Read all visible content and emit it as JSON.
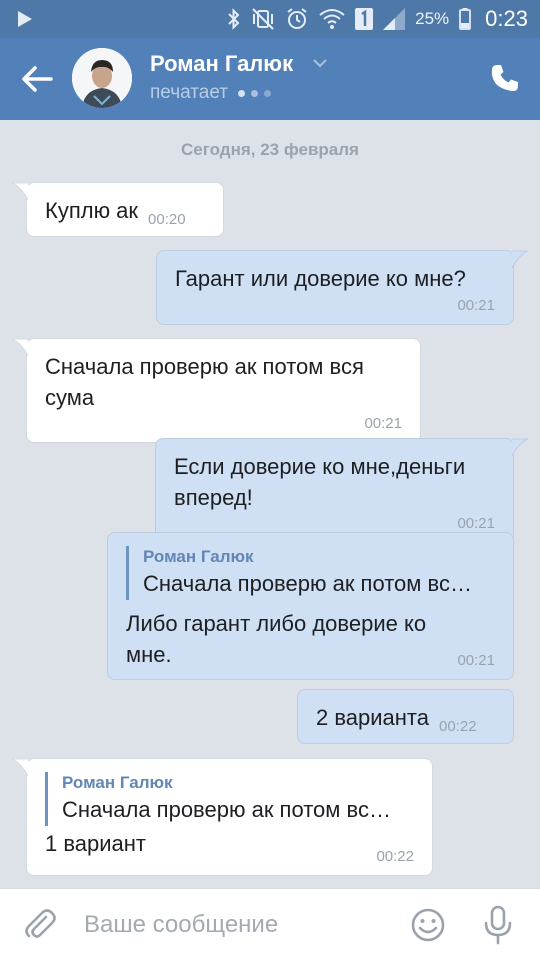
{
  "status_bar": {
    "battery_percent": "25%",
    "time": "0:23",
    "icons": [
      "play-icon",
      "bluetooth-icon",
      "vibrate-mute-icon",
      "alarm-icon",
      "wifi-icon",
      "sim-1-icon",
      "signal-icon",
      "battery-icon"
    ]
  },
  "header": {
    "contact_name": "Роман Галюк",
    "status": "печатает",
    "icons": [
      "back-arrow-icon",
      "avatar",
      "chevron-down-icon",
      "phone-icon"
    ],
    "background": "#5181b8"
  },
  "chat": {
    "date_separator": "Сегодня, 23 февраля",
    "messages": [
      {
        "direction": "in",
        "text": "Куплю ак",
        "time": "00:20"
      },
      {
        "direction": "out",
        "text": "Гарант или доверие ко мне?",
        "time": "00:21"
      },
      {
        "direction": "in",
        "text": "Сначала проверю ак потом вся сума",
        "time": "00:21"
      },
      {
        "direction": "out",
        "text": "Если доверие ко мне,деньги вперед!",
        "time": "00:21"
      },
      {
        "direction": "out",
        "reply": {
          "name": "Роман Галюк",
          "text": "Сначала проверю ак потом вс…"
        },
        "text": "Либо гарант либо доверие ко мне.",
        "time": "00:21"
      },
      {
        "direction": "out",
        "text": "2 варианта",
        "time": "00:22"
      },
      {
        "direction": "in",
        "reply": {
          "name": "Роман Галюк",
          "text": "Сначала проверю ак потом вс…"
        },
        "text": "1 вариант",
        "time": "00:22"
      }
    ],
    "colors": {
      "incoming_bubble": "#ffffff",
      "outgoing_bubble": "#cfe0f5",
      "reply_name": "#6387b5"
    }
  },
  "input_bar": {
    "placeholder": "Ваше сообщение",
    "icons": [
      "paperclip-icon",
      "emoji-icon",
      "microphone-icon"
    ]
  }
}
